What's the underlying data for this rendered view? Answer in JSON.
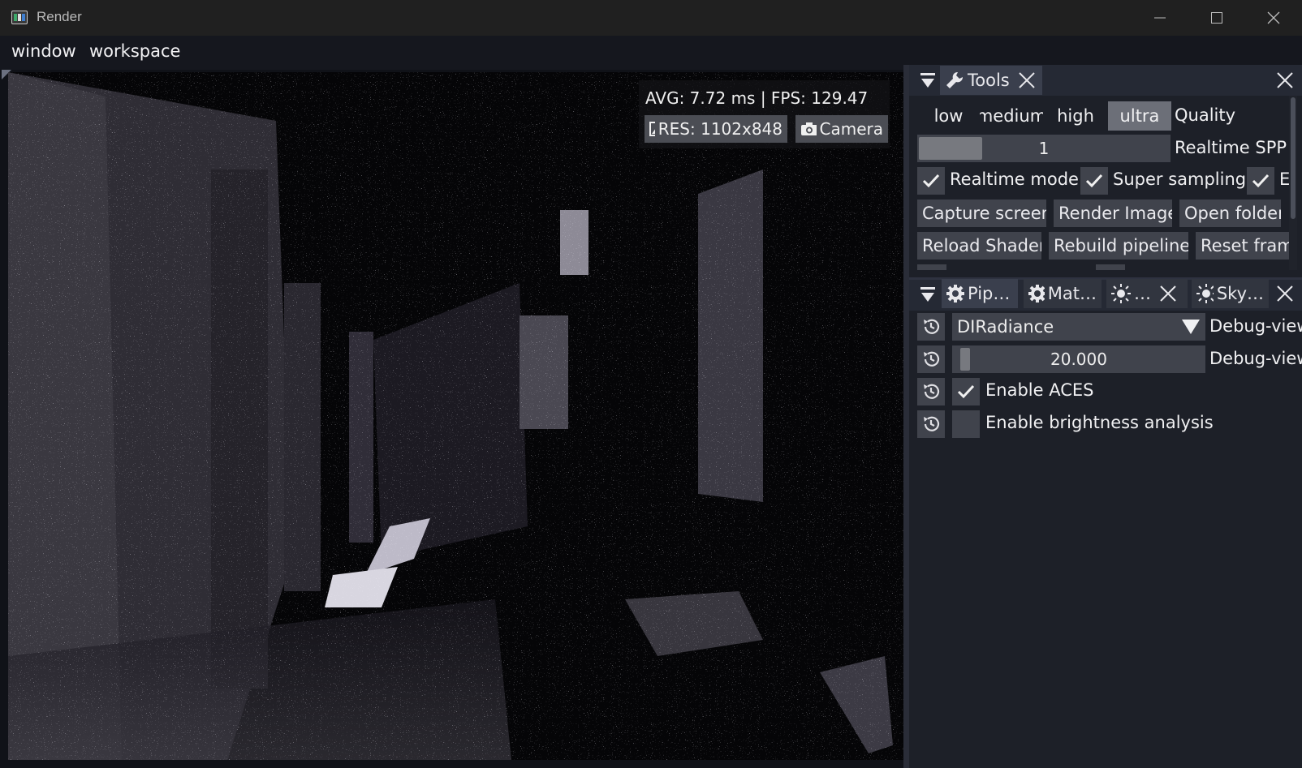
{
  "window": {
    "title": "Render"
  },
  "menubar": {
    "items": [
      "window",
      "workspace"
    ]
  },
  "viewport": {
    "stats": "AVG: 7.72 ms | FPS: 129.47",
    "res_label": "RES: 1102x848",
    "camera_label": "Camera"
  },
  "tools_panel": {
    "tab_label": "Tools",
    "quality": {
      "options": [
        "low",
        "medium",
        "high",
        "ultra"
      ],
      "selected": "ultra",
      "label": "Quality"
    },
    "realtime_spp": {
      "value": "1",
      "label": "Realtime SPP"
    },
    "checkboxes": [
      {
        "label": "Realtime mode",
        "checked": true
      },
      {
        "label": "Super sampling",
        "checked": true
      },
      {
        "label": "E",
        "checked": true
      }
    ],
    "buttons_row1": [
      "Capture screen",
      "Render Image",
      "Open folder"
    ],
    "buttons_row2": [
      "Reload Shader",
      "Rebuild pipeline",
      "Reset frame"
    ]
  },
  "pipeline_panel": {
    "tabs": [
      "Pip…",
      "Mat…",
      "…",
      "Sky…"
    ],
    "debug_view_mode": {
      "value": "DIRadiance",
      "label": "Debug-view"
    },
    "debug_view_scale": {
      "value": "20.000",
      "label": "Debug-view"
    },
    "toggles": [
      {
        "label": "Enable ACES",
        "checked": true
      },
      {
        "label": "Enable brightness analysis",
        "checked": false
      }
    ]
  },
  "colors": {
    "titlebar": "#202020",
    "menubar": "#15171e",
    "dock_bg": "#1d2028",
    "widget_bg": "#40434c",
    "selected": "#6c6f78"
  }
}
